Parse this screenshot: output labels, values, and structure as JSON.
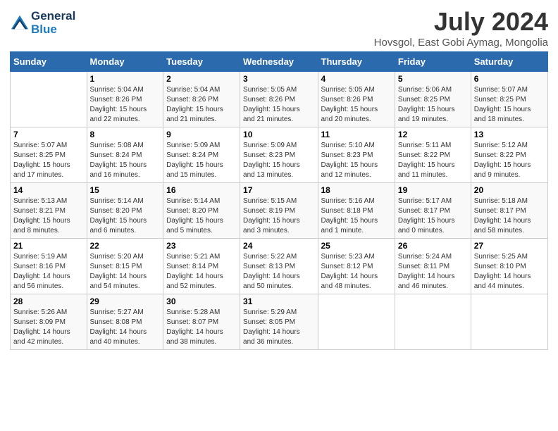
{
  "header": {
    "logo_line1": "General",
    "logo_line2": "Blue",
    "month": "July 2024",
    "location": "Hovsgol, East Gobi Aymag, Mongolia"
  },
  "days_of_week": [
    "Sunday",
    "Monday",
    "Tuesday",
    "Wednesday",
    "Thursday",
    "Friday",
    "Saturday"
  ],
  "weeks": [
    [
      {
        "day": "",
        "info": ""
      },
      {
        "day": "1",
        "info": "Sunrise: 5:04 AM\nSunset: 8:26 PM\nDaylight: 15 hours\nand 22 minutes."
      },
      {
        "day": "2",
        "info": "Sunrise: 5:04 AM\nSunset: 8:26 PM\nDaylight: 15 hours\nand 21 minutes."
      },
      {
        "day": "3",
        "info": "Sunrise: 5:05 AM\nSunset: 8:26 PM\nDaylight: 15 hours\nand 21 minutes."
      },
      {
        "day": "4",
        "info": "Sunrise: 5:05 AM\nSunset: 8:26 PM\nDaylight: 15 hours\nand 20 minutes."
      },
      {
        "day": "5",
        "info": "Sunrise: 5:06 AM\nSunset: 8:25 PM\nDaylight: 15 hours\nand 19 minutes."
      },
      {
        "day": "6",
        "info": "Sunrise: 5:07 AM\nSunset: 8:25 PM\nDaylight: 15 hours\nand 18 minutes."
      }
    ],
    [
      {
        "day": "7",
        "info": "Sunrise: 5:07 AM\nSunset: 8:25 PM\nDaylight: 15 hours\nand 17 minutes."
      },
      {
        "day": "8",
        "info": "Sunrise: 5:08 AM\nSunset: 8:24 PM\nDaylight: 15 hours\nand 16 minutes."
      },
      {
        "day": "9",
        "info": "Sunrise: 5:09 AM\nSunset: 8:24 PM\nDaylight: 15 hours\nand 15 minutes."
      },
      {
        "day": "10",
        "info": "Sunrise: 5:09 AM\nSunset: 8:23 PM\nDaylight: 15 hours\nand 13 minutes."
      },
      {
        "day": "11",
        "info": "Sunrise: 5:10 AM\nSunset: 8:23 PM\nDaylight: 15 hours\nand 12 minutes."
      },
      {
        "day": "12",
        "info": "Sunrise: 5:11 AM\nSunset: 8:22 PM\nDaylight: 15 hours\nand 11 minutes."
      },
      {
        "day": "13",
        "info": "Sunrise: 5:12 AM\nSunset: 8:22 PM\nDaylight: 15 hours\nand 9 minutes."
      }
    ],
    [
      {
        "day": "14",
        "info": "Sunrise: 5:13 AM\nSunset: 8:21 PM\nDaylight: 15 hours\nand 8 minutes."
      },
      {
        "day": "15",
        "info": "Sunrise: 5:14 AM\nSunset: 8:20 PM\nDaylight: 15 hours\nand 6 minutes."
      },
      {
        "day": "16",
        "info": "Sunrise: 5:14 AM\nSunset: 8:20 PM\nDaylight: 15 hours\nand 5 minutes."
      },
      {
        "day": "17",
        "info": "Sunrise: 5:15 AM\nSunset: 8:19 PM\nDaylight: 15 hours\nand 3 minutes."
      },
      {
        "day": "18",
        "info": "Sunrise: 5:16 AM\nSunset: 8:18 PM\nDaylight: 15 hours\nand 1 minute."
      },
      {
        "day": "19",
        "info": "Sunrise: 5:17 AM\nSunset: 8:17 PM\nDaylight: 15 hours\nand 0 minutes."
      },
      {
        "day": "20",
        "info": "Sunrise: 5:18 AM\nSunset: 8:17 PM\nDaylight: 14 hours\nand 58 minutes."
      }
    ],
    [
      {
        "day": "21",
        "info": "Sunrise: 5:19 AM\nSunset: 8:16 PM\nDaylight: 14 hours\nand 56 minutes."
      },
      {
        "day": "22",
        "info": "Sunrise: 5:20 AM\nSunset: 8:15 PM\nDaylight: 14 hours\nand 54 minutes."
      },
      {
        "day": "23",
        "info": "Sunrise: 5:21 AM\nSunset: 8:14 PM\nDaylight: 14 hours\nand 52 minutes."
      },
      {
        "day": "24",
        "info": "Sunrise: 5:22 AM\nSunset: 8:13 PM\nDaylight: 14 hours\nand 50 minutes."
      },
      {
        "day": "25",
        "info": "Sunrise: 5:23 AM\nSunset: 8:12 PM\nDaylight: 14 hours\nand 48 minutes."
      },
      {
        "day": "26",
        "info": "Sunrise: 5:24 AM\nSunset: 8:11 PM\nDaylight: 14 hours\nand 46 minutes."
      },
      {
        "day": "27",
        "info": "Sunrise: 5:25 AM\nSunset: 8:10 PM\nDaylight: 14 hours\nand 44 minutes."
      }
    ],
    [
      {
        "day": "28",
        "info": "Sunrise: 5:26 AM\nSunset: 8:09 PM\nDaylight: 14 hours\nand 42 minutes."
      },
      {
        "day": "29",
        "info": "Sunrise: 5:27 AM\nSunset: 8:08 PM\nDaylight: 14 hours\nand 40 minutes."
      },
      {
        "day": "30",
        "info": "Sunrise: 5:28 AM\nSunset: 8:07 PM\nDaylight: 14 hours\nand 38 minutes."
      },
      {
        "day": "31",
        "info": "Sunrise: 5:29 AM\nSunset: 8:05 PM\nDaylight: 14 hours\nand 36 minutes."
      },
      {
        "day": "",
        "info": ""
      },
      {
        "day": "",
        "info": ""
      },
      {
        "day": "",
        "info": ""
      }
    ]
  ]
}
